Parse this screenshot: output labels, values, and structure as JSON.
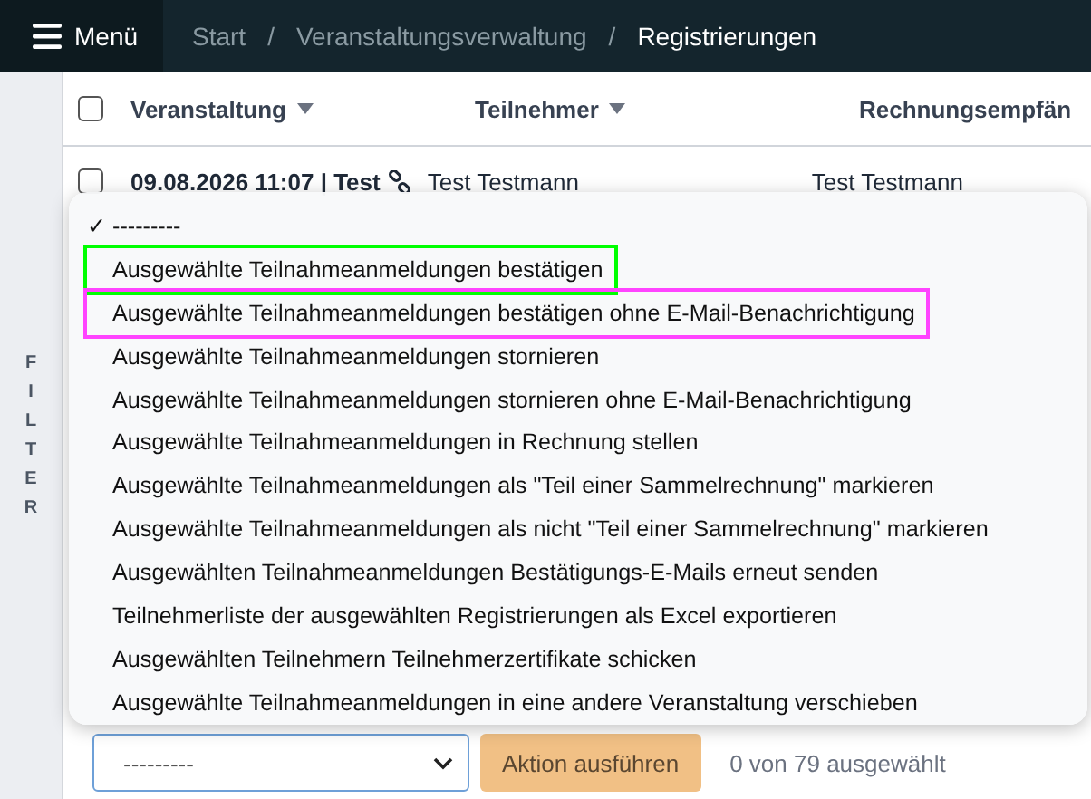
{
  "topbar": {
    "menu_label": "Menü",
    "separator": "/",
    "breadcrumbs": [
      {
        "label": "Start",
        "current": false
      },
      {
        "label": "Veranstaltungsverwaltung",
        "current": false
      },
      {
        "label": "Registrierungen",
        "current": true
      }
    ]
  },
  "sidebar": {
    "filter_label": "FILTER"
  },
  "table": {
    "select_all_checked": false,
    "columns": [
      {
        "label": "Veranstaltung",
        "sortable": true
      },
      {
        "label": "Teilnehmer",
        "sortable": true
      },
      {
        "label": "Rechnungsempfän"
      }
    ],
    "rows": [
      {
        "checked": false,
        "cells": [
          "09.08.2026 11:07 | Test",
          "Test Testmann",
          "Test Testmann"
        ]
      }
    ]
  },
  "action_menu": {
    "check_mark": "✓",
    "items": [
      {
        "label": "---------",
        "selected": true
      },
      {
        "label": "Ausgewählte Teilnahmeanmeldungen bestätigen",
        "selected": false,
        "color": "#00ff00"
      },
      {
        "label": "Ausgewählte Teilnahmeanmeldungen bestätigen ohne E-Mail-Benachrichtigung",
        "selected": false,
        "color": "#ff44ff"
      },
      {
        "label": "Ausgewählte Teilnahmeanmeldungen stornieren",
        "selected": false
      },
      {
        "label": "Ausgewählte Teilnahmeanmeldungen stornieren ohne E-Mail-Benachrichtigung",
        "selected": false
      },
      {
        "label": "Ausgewählte Teilnahmeanmeldungen in Rechnung stellen",
        "selected": false
      },
      {
        "label": "Ausgewählte Teilnahmeanmeldungen als \"Teil einer Sammelrechnung\" markieren",
        "selected": false
      },
      {
        "label": "Ausgewählte Teilnahmeanmeldungen als nicht \"Teil einer Sammelrechnung\" markieren",
        "selected": false
      },
      {
        "label": "Ausgewählten Teilnahmeanmeldungen Bestätigungs-E-Mails erneut senden",
        "selected": false
      },
      {
        "label": "Teilnehmerliste der ausgewählten Registrierungen als Excel exportieren",
        "selected": false
      },
      {
        "label": "Ausgewählten Teilnehmern Teilnehmerzertifikate schicken",
        "selected": false
      },
      {
        "label": "Ausgewählte Teilnahmeanmeldungen in eine andere Veranstaltung verschieben",
        "selected": false
      }
    ]
  },
  "action_bar": {
    "select_value": "---------",
    "button": "Aktion ausführen",
    "count": "0 von 79 ausgewählt"
  }
}
